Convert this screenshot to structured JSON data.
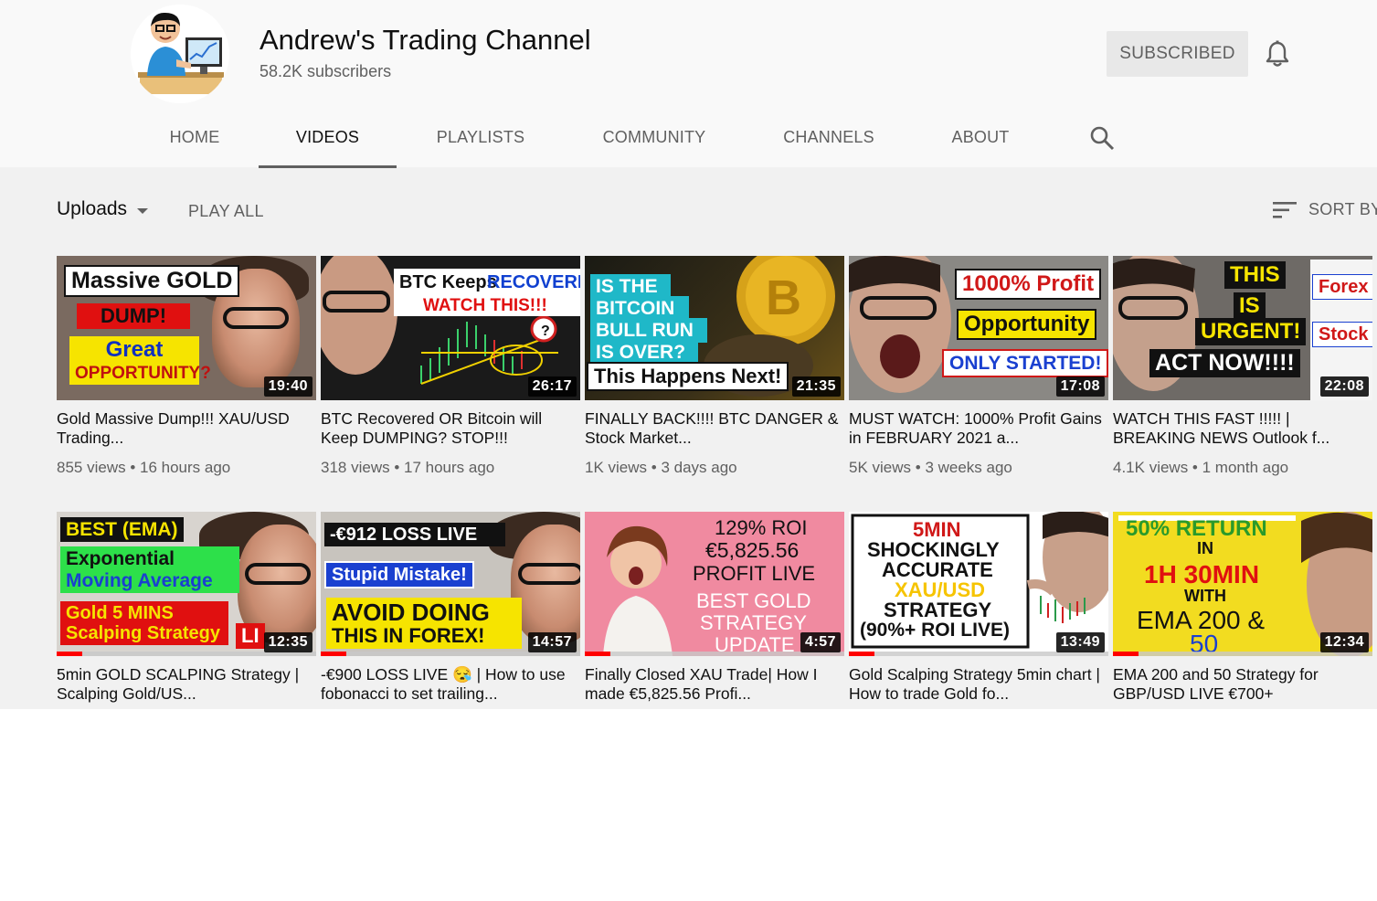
{
  "channel": {
    "name": "Andrew's Trading Channel",
    "subscribers": "58.2K subscribers",
    "subscribe_label": "SUBSCRIBED"
  },
  "tabs": [
    {
      "label": "HOME",
      "active": false
    },
    {
      "label": "VIDEOS",
      "active": true
    },
    {
      "label": "PLAYLISTS",
      "active": false
    },
    {
      "label": "COMMUNITY",
      "active": false
    },
    {
      "label": "CHANNELS",
      "active": false
    },
    {
      "label": "ABOUT",
      "active": false
    }
  ],
  "toolbar": {
    "uploads_label": "Uploads",
    "play_all_label": "PLAY ALL",
    "sort_label": "SORT BY"
  },
  "icons": {
    "bell": "bell-icon",
    "search": "search-icon",
    "sort": "sort-icon",
    "dropdown": "caret-down-icon"
  },
  "videos": [
    {
      "title": "Gold Massive Dump!!! XAU/USD Trading...",
      "views": "855 views",
      "age": "16 hours ago",
      "duration": "19:40",
      "progress": 0,
      "thumb_text": [
        "Massive GOLD",
        "DUMP!",
        "Great",
        "OPPORTUNITY?"
      ],
      "bg": "#7a6a60"
    },
    {
      "title": "BTC Recovered OR Bitcoin will Keep DUMPING? STOP!!!",
      "views": "318 views",
      "age": "17 hours ago",
      "duration": "26:17",
      "progress": 0,
      "thumb_text": [
        "BTC Keeps",
        "RECOVERING",
        "WATCH THIS!!!",
        "?"
      ],
      "bg": "#1a1a1a"
    },
    {
      "title": "FINALLY BACK!!!! BTC DANGER & Stock Market...",
      "views": "1K views",
      "age": "3 days ago",
      "duration": "21:35",
      "progress": 0,
      "thumb_text": [
        "IS THE",
        "BITCOIN",
        "BULL RUN",
        "IS OVER?",
        "This Happens Next!"
      ],
      "bg": "#2a2410"
    },
    {
      "title": "MUST WATCH: 1000% Profit Gains in FEBRUARY 2021 a...",
      "views": "5K views",
      "age": "3 weeks ago",
      "duration": "17:08",
      "progress": 0,
      "thumb_text": [
        "1000% Profit",
        "Opportunity",
        "ONLY STARTED!"
      ],
      "bg": "#8a8884"
    },
    {
      "title": "WATCH THIS FAST !!!!! | BREAKING NEWS Outlook f...",
      "views": "4.1K views",
      "age": "1 month ago",
      "duration": "22:08",
      "progress": 0,
      "thumb_text": [
        "THIS",
        "IS",
        "URGENT!",
        "ACT NOW!!!!",
        "Forex",
        "Stock"
      ],
      "bg": "#6e6a66"
    },
    {
      "title": "5min GOLD SCALPING Strategy | Scalping Gold/US...",
      "views": "",
      "age": "",
      "duration": "12:35",
      "progress": 10,
      "thumb_text": [
        "BEST (EMA)",
        "Exponential",
        "Moving Average",
        "Gold 5 MINS",
        "Scalping Strategy",
        "LI"
      ],
      "bg": "#d8d4cf"
    },
    {
      "title": "-€900 LOSS LIVE 😪 | How to use fobonacci to set trailing...",
      "views": "",
      "age": "",
      "duration": "14:57",
      "progress": 10,
      "thumb_text": [
        "-€912 LOSS LIVE",
        "Stupid Mistake!",
        "AVOID DOING",
        "THIS IN FOREX!"
      ],
      "bg": "#c8c4be"
    },
    {
      "title": "Finally Closed XAU Trade| How I made €5,825.56 Profi...",
      "views": "",
      "age": "",
      "duration": "4:57",
      "progress": 10,
      "thumb_text": [
        "129% ROI",
        "€5,825.56",
        "PROFIT LIVE",
        "BEST GOLD",
        "STRATEGY",
        "UPDATE"
      ],
      "bg": "#f08aa0"
    },
    {
      "title": "Gold Scalping Strategy 5min chart | How to trade Gold fo...",
      "views": "",
      "age": "",
      "duration": "13:49",
      "progress": 10,
      "thumb_text": [
        "5MIN",
        "SHOCKINGLY",
        "ACCURATE",
        "XAU/USD",
        "STRATEGY",
        "(90%+ ROI LIVE)"
      ],
      "bg": "#ffffff"
    },
    {
      "title": "EMA 200 and 50 Strategy for GBP/USD LIVE €700+",
      "views": "",
      "age": "",
      "duration": "12:34",
      "progress": 10,
      "thumb_text": [
        "50% RETURN",
        "IN",
        "1H 30MIN",
        "WITH",
        "EMA 200 &",
        "50"
      ],
      "bg": "#f2dc20"
    }
  ]
}
